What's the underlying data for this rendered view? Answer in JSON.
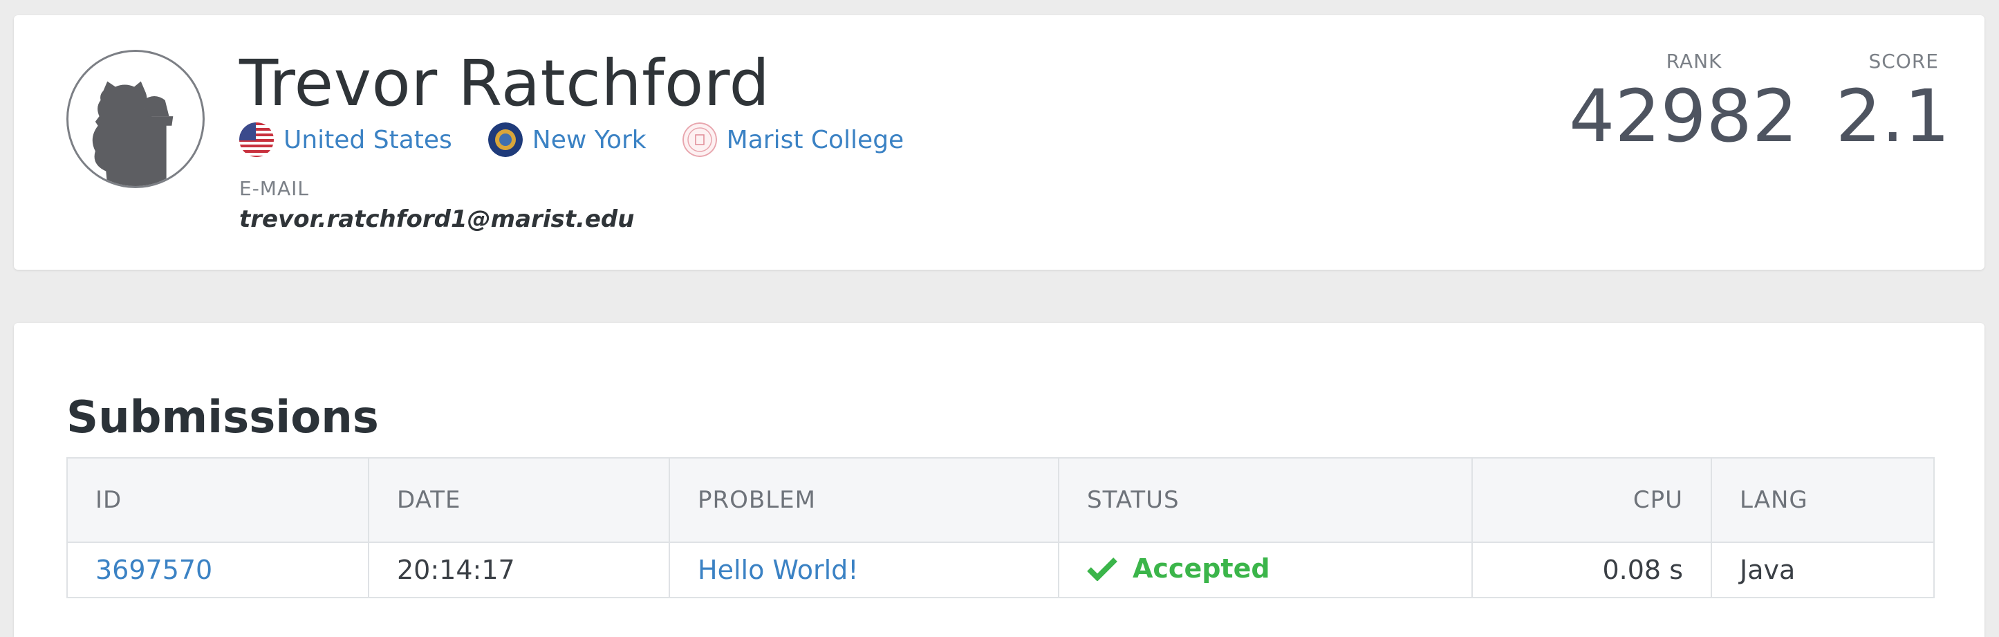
{
  "profile": {
    "name": "Trevor Ratchford",
    "affiliations": [
      {
        "label": "United States",
        "icon": "us-flag-icon"
      },
      {
        "label": "New York",
        "icon": "new-york-seal-icon"
      },
      {
        "label": "Marist College",
        "icon": "marist-college-seal-icon"
      }
    ],
    "email_label": "E-MAIL",
    "email": "trevor.ratchford1@marist.edu"
  },
  "stats": {
    "rank_label": "RANK",
    "rank": "42982",
    "score_label": "SCORE",
    "score": "2.1"
  },
  "submissions": {
    "title": "Submissions",
    "columns": [
      "ID",
      "DATE",
      "PROBLEM",
      "STATUS",
      "CPU",
      "LANG"
    ],
    "rows": [
      {
        "id": "3697570",
        "date": "20:14:17",
        "problem": "Hello World!",
        "status": "Accepted",
        "cpu": "0.08 s",
        "lang": "Java"
      }
    ]
  },
  "colors": {
    "link": "#3b82c4",
    "accepted": "#3bb54a",
    "background": "#ececec"
  }
}
